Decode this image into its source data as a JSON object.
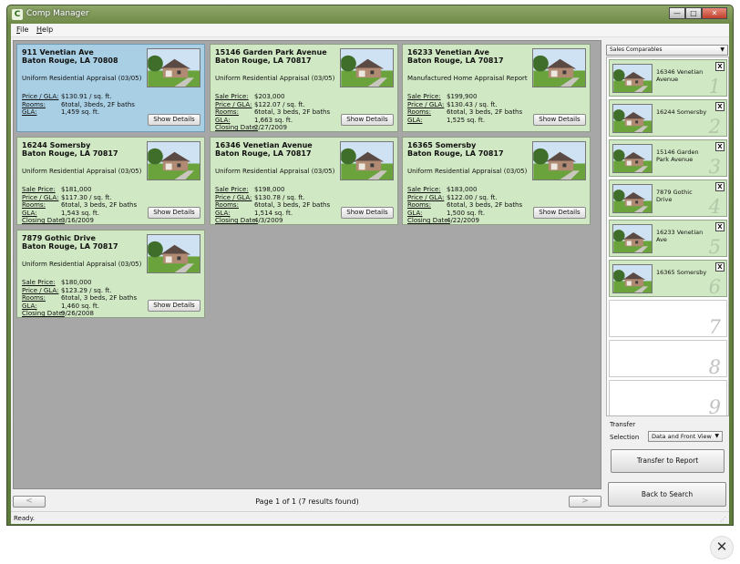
{
  "window": {
    "title": "Comp Manager",
    "app_icon": "C",
    "min": "—",
    "max": "□",
    "close": "✕"
  },
  "menu": [
    {
      "label": "File",
      "accel": "F",
      "rest": "ile"
    },
    {
      "label": "Help",
      "accel": "H",
      "rest": "elp"
    }
  ],
  "card_labels": {
    "sale_price": "Sale Price:",
    "price_gla": "Price / GLA:",
    "rooms": "Rooms:",
    "gla": "GLA:",
    "closing_date": "Closing Date:",
    "show_details": "Show Details"
  },
  "cards": [
    {
      "line1": "911 Venetian Ave",
      "line2": "Baton Rouge, LA 70808",
      "type": "Uniform Residential Appraisal (03/05)",
      "sale_price": "",
      "price_gla": "$130.91 / sq. ft.",
      "rooms": "6total, 3beds, 2F baths",
      "gla": "1,459 sq. ft.",
      "closing_date": ""
    },
    {
      "line1": "15146 Garden Park Avenue",
      "line2": "Baton Rouge, LA 70817",
      "type": "Uniform Residential Appraisal (03/05)",
      "sale_price": "$203,000",
      "price_gla": "$122.07 / sq. ft.",
      "rooms": "6total, 3 beds, 2F baths",
      "gla": "1,663 sq. ft.",
      "closing_date": "2/27/2009"
    },
    {
      "line1": "16233 Venetian Ave",
      "line2": "Baton Rouge, LA 70817",
      "type": "Manufactured Home Appraisal Report",
      "sale_price": "$199,900",
      "price_gla": "$130.43 / sq. ft.",
      "rooms": "6total, 3 beds, 2F baths",
      "gla": "1,525 sq. ft.",
      "closing_date": ""
    },
    {
      "line1": "16244 Somersby",
      "line2": "Baton Rouge, LA 70817",
      "type": "Uniform Residential Appraisal (03/05)",
      "sale_price": "$181,000",
      "price_gla": "$117.30 / sq. ft.",
      "rooms": "6total, 3 beds, 2F baths",
      "gla": "1,543 sq. ft.",
      "closing_date": "3/16/2009"
    },
    {
      "line1": "16346 Venetian Avenue",
      "line2": "Baton Rouge, LA 70817",
      "type": "Uniform Residential Appraisal (03/05)",
      "sale_price": "$198,000",
      "price_gla": "$130.78 / sq. ft.",
      "rooms": "6total, 3 beds, 2F baths",
      "gla": "1,514 sq. ft.",
      "closing_date": "4/3/2009"
    },
    {
      "line1": "16365 Somersby",
      "line2": "Baton Rouge, LA 70817",
      "type": "Uniform Residential Appraisal (03/05)",
      "sale_price": "$183,000",
      "price_gla": "$122.00 / sq. ft.",
      "rooms": "6total, 3 beds, 2F baths",
      "gla": "1,500 sq. ft.",
      "closing_date": "4/22/2009"
    },
    {
      "line1": "7879 Gothic Drive",
      "line2": "Baton Rouge, LA 70817",
      "type": "Uniform Residential Appraisal (03/05)",
      "sale_price": "$180,000",
      "price_gla": "$123.29 / sq. ft.",
      "rooms": "6total, 3 beds, 2F baths",
      "gla": "1,460 sq. ft.",
      "closing_date": "9/26/2008"
    }
  ],
  "pager": {
    "prev": "<",
    "next": ">",
    "text": "Page 1 of 1 (7 results found)"
  },
  "status": "Ready.",
  "comparables": {
    "dropdown": "Sales Comparables",
    "remove": "X",
    "slots": [
      {
        "number": "1",
        "label": "16346 Venetian Avenue"
      },
      {
        "number": "2",
        "label": "16244 Somersby"
      },
      {
        "number": "3",
        "label": "15146 Garden Park Avenue"
      },
      {
        "number": "4",
        "label": "7879 Gothic Drive"
      },
      {
        "number": "5",
        "label": "16233 Venetian Ave"
      },
      {
        "number": "6",
        "label": "16365 Somersby"
      },
      {
        "number": "7",
        "label": ""
      },
      {
        "number": "8",
        "label": ""
      },
      {
        "number": "9",
        "label": ""
      }
    ]
  },
  "transfer": {
    "label": "Transfer",
    "selection_label": "Selection",
    "selection_value": "Data and Front View",
    "transfer_button": "Transfer to Report",
    "back_button": "Back to Search"
  },
  "overlay_close": "✕"
}
